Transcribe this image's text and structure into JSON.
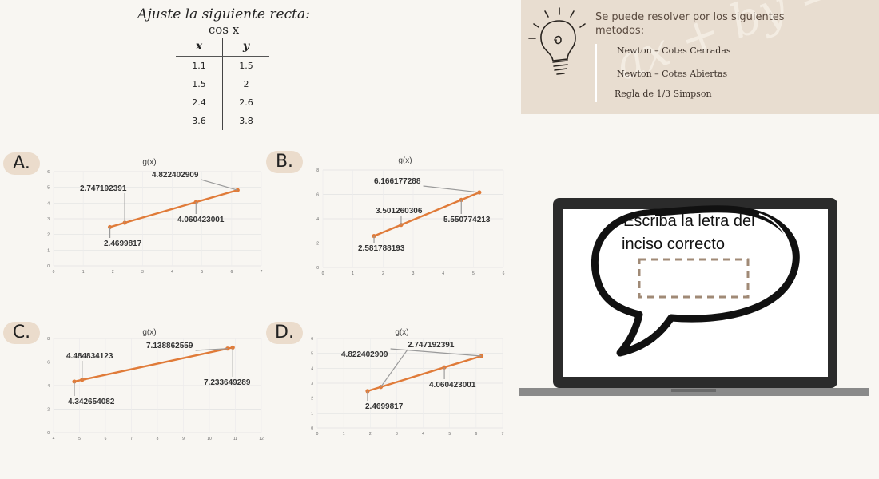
{
  "problem": {
    "title": "Ajuste la siguiente recta:",
    "function": "cos x",
    "table": {
      "headers": [
        "x",
        "y"
      ],
      "rows": [
        [
          "1.1",
          "1.5"
        ],
        [
          "1.5",
          "2"
        ],
        [
          "2.4",
          "2.6"
        ],
        [
          "3.6",
          "3.8"
        ]
      ]
    }
  },
  "info_panel": {
    "intro": "Se puede resolver por los siguientes metodos:",
    "methods": [
      "Newton – Cotes Cerradas",
      "Newton – Cotes Abiertas",
      "Regla de 1/3 Simpson"
    ],
    "decoration": "ax + by = c",
    "icon": "lightbulb-icon"
  },
  "options": [
    "A.",
    "B.",
    "C.",
    "D."
  ],
  "chart_data": [
    {
      "id": "A",
      "type": "line",
      "title": "g(x)",
      "xlim": [
        0,
        7
      ],
      "ylim": [
        0,
        6
      ],
      "grid": true,
      "x_ticks": [
        "0",
        "1",
        "2",
        "3",
        "4",
        "5",
        "6",
        "7"
      ],
      "y_ticks": [
        "0",
        "1",
        "2",
        "3",
        "4",
        "5",
        "6"
      ],
      "points": [
        [
          1.9,
          2.47
        ],
        [
          2.4,
          2.747192391
        ],
        [
          4.8,
          4.060423001
        ],
        [
          6.2,
          4.822402909
        ]
      ],
      "labels": [
        {
          "text": "2.747192391",
          "point": 1
        },
        {
          "text": "4.822402909",
          "point": 3
        },
        {
          "text": "4.060423001",
          "point": 2
        },
        {
          "text": "2.4699817",
          "point": 0
        }
      ],
      "color": "#e07b39"
    },
    {
      "id": "B",
      "type": "line",
      "title": "g(x)",
      "xlim": [
        0,
        6
      ],
      "ylim": [
        0,
        8
      ],
      "grid": true,
      "x_ticks": [
        "0",
        "1",
        "2",
        "3",
        "4",
        "5",
        "6"
      ],
      "y_ticks": [
        "0",
        "2",
        "4",
        "6",
        "8"
      ],
      "points": [
        [
          1.7,
          2.581788193
        ],
        [
          2.6,
          3.501260306
        ],
        [
          4.6,
          5.550774213
        ],
        [
          5.2,
          6.166177288
        ]
      ],
      "labels": [
        {
          "text": "6.166177288",
          "point": 3
        },
        {
          "text": "3.501260306",
          "point": 1
        },
        {
          "text": "5.550774213",
          "point": 2
        },
        {
          "text": "2.581788193",
          "point": 0
        }
      ],
      "color": "#e07b39"
    },
    {
      "id": "C",
      "type": "line",
      "title": "g(x)",
      "xlim": [
        4,
        12
      ],
      "ylim": [
        0,
        8
      ],
      "grid": true,
      "x_ticks": [
        "4",
        "5",
        "6",
        "7",
        "8",
        "9",
        "10",
        "11",
        "12"
      ],
      "y_ticks": [
        "0",
        "2",
        "4",
        "6",
        "8"
      ],
      "points": [
        [
          4.8,
          4.342654082
        ],
        [
          5.1,
          4.484834123
        ],
        [
          10.7,
          7.138862559
        ],
        [
          10.9,
          7.233649289
        ]
      ],
      "labels": [
        {
          "text": "4.484834123",
          "point": 1
        },
        {
          "text": "7.138862559",
          "point": 2
        },
        {
          "text": "7.233649289",
          "point": 3
        },
        {
          "text": "4.342654082",
          "point": 0
        }
      ],
      "color": "#e07b39"
    },
    {
      "id": "D",
      "type": "line",
      "title": "g(x)",
      "xlim": [
        0,
        7
      ],
      "ylim": [
        0,
        6
      ],
      "grid": true,
      "x_ticks": [
        "0",
        "1",
        "2",
        "3",
        "4",
        "5",
        "6",
        "7"
      ],
      "y_ticks": [
        "0",
        "1",
        "2",
        "3",
        "4",
        "5",
        "6"
      ],
      "points": [
        [
          1.9,
          2.47
        ],
        [
          2.4,
          2.747192391
        ],
        [
          4.8,
          4.060423001
        ],
        [
          6.2,
          4.822402909
        ]
      ],
      "labels": [
        {
          "text": "4.822402909",
          "point": 3
        },
        {
          "text": "2.747192391",
          "point": 1
        },
        {
          "text": "4.060423001",
          "point": 2
        },
        {
          "text": "2.4699817",
          "point": 0
        }
      ],
      "color": "#e07b39"
    }
  ],
  "laptop": {
    "prompt_line1": "Escriba la letra del",
    "prompt_line2": "inciso correcto",
    "answer_box": ""
  },
  "colors": {
    "background": "#f8f6f2",
    "panel": "#e8ddd0",
    "label_bg": "#ebdccc",
    "series": "#e07b39",
    "answer_border": "#a08a76"
  }
}
